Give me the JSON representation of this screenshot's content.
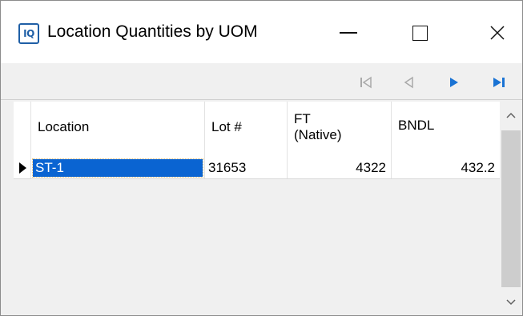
{
  "window": {
    "title": "Location Quantities by UOM",
    "icon_text": "IQ",
    "controls": [
      "minimize-icon",
      "maximize-icon",
      "close-icon"
    ]
  },
  "navigation": {
    "buttons": [
      {
        "name": "first-record-icon",
        "enabled": false
      },
      {
        "name": "previous-record-icon",
        "enabled": false
      },
      {
        "name": "next-record-icon",
        "enabled": true
      },
      {
        "name": "last-record-icon",
        "enabled": true
      }
    ],
    "enabled_color": "#1a73d4",
    "disabled_color": "#a9a9a9"
  },
  "grid": {
    "columns": [
      {
        "label": "Location"
      },
      {
        "label": "Lot #"
      },
      {
        "label": "FT",
        "sublabel": "(Native)"
      },
      {
        "label": "BNDL"
      }
    ],
    "rows": [
      {
        "location": "ST-1",
        "lot": "31653",
        "ft": "4322",
        "bndl": "432.2",
        "selected": true
      }
    ],
    "selection_color": "#0a64d2"
  }
}
